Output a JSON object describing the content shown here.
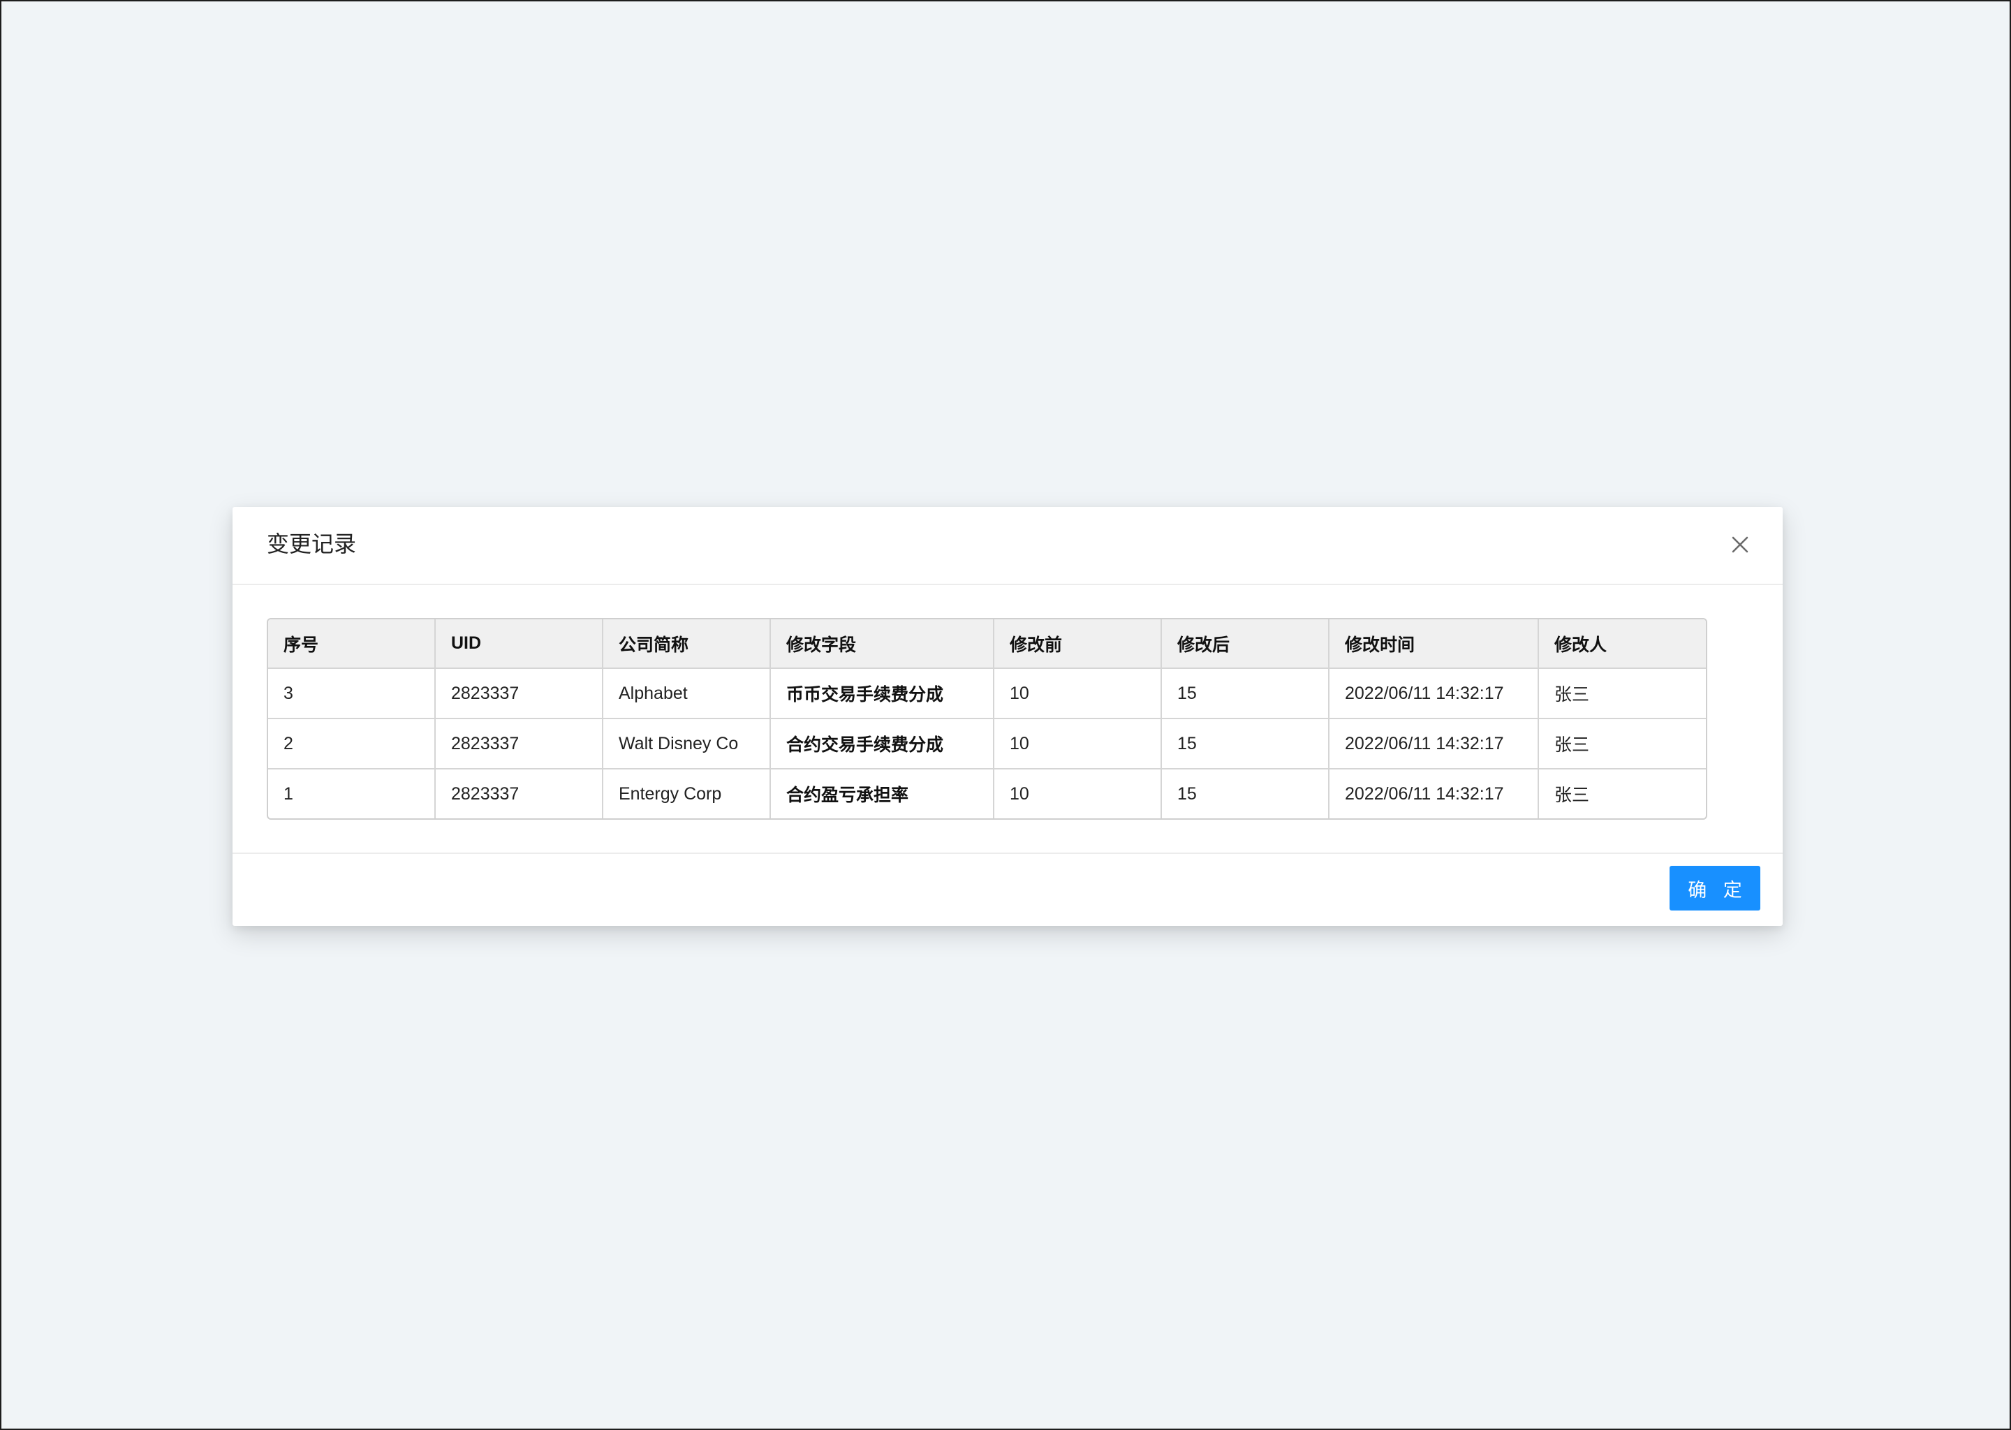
{
  "modal": {
    "title": "变更记录",
    "close_icon": "close-icon",
    "ok_label": "确 定"
  },
  "table": {
    "headers": [
      "序号",
      "UID",
      "公司简称",
      "修改字段",
      "修改前",
      "修改后",
      "修改时间",
      "修改人"
    ],
    "rows": [
      [
        "3",
        "2823337",
        "Alphabet",
        "币币交易手续费分成",
        "10",
        "15",
        "2022/06/11 14:32:17",
        "张三"
      ],
      [
        "2",
        "2823337",
        "Walt Disney Co",
        "合约交易手续费分成",
        "10",
        "15",
        "2022/06/11 14:32:17",
        "张三"
      ],
      [
        "1",
        "2823337",
        "Entergy Corp",
        "合约盈亏承担率",
        "10",
        "15",
        "2022/06/11 14:32:17",
        "张三"
      ]
    ]
  },
  "colors": {
    "page_background": "#f0f4f7",
    "header_row_background": "#f0f0f0",
    "primary": "#1890ff"
  }
}
